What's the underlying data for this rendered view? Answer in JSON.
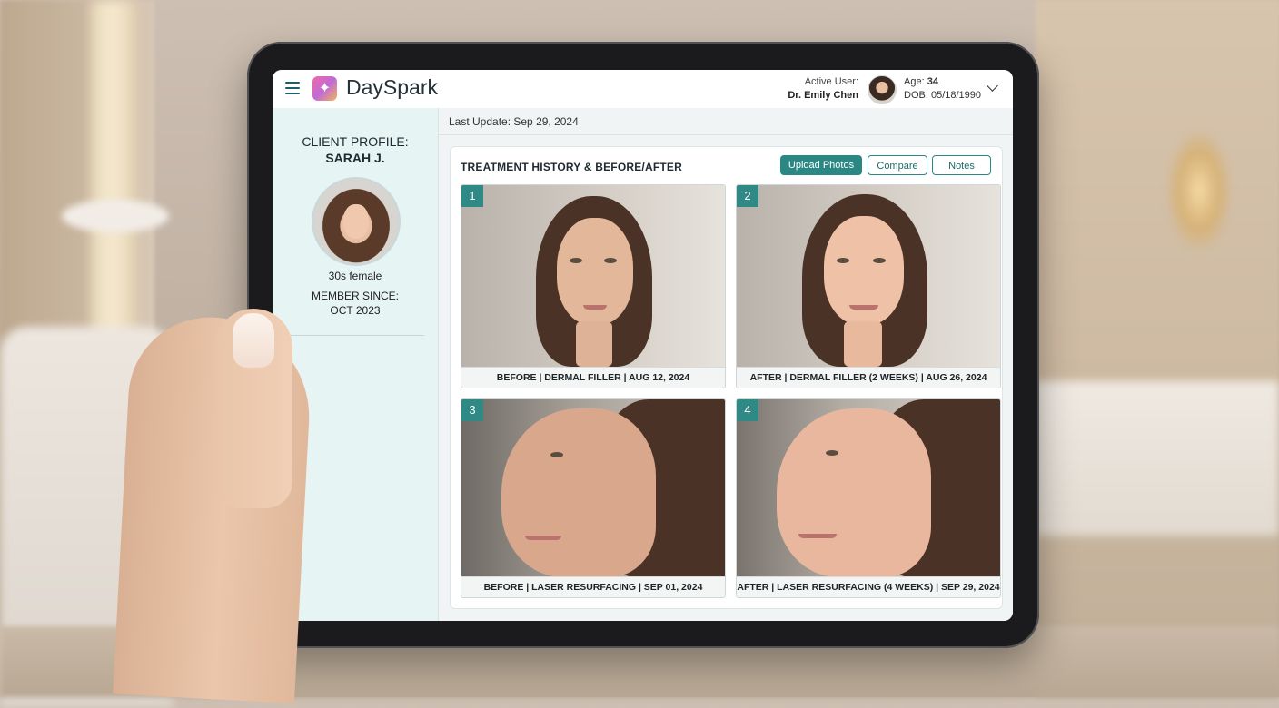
{
  "app": {
    "name": "DaySpark"
  },
  "header": {
    "active_user_label": "Active User:",
    "active_user_name": "Dr. Emily Chen",
    "age_label": "Age:",
    "age_value": "34",
    "dob_label": "DOB:",
    "dob_value": "05/18/1990"
  },
  "sidebar": {
    "profile_label": "CLIENT PROFILE:",
    "client_name": "SARAH J.",
    "description": "30s female",
    "member_since_label": "MEMBER SINCE:",
    "member_since_value": "OCT 2023"
  },
  "main": {
    "last_update": "Last Update: Sep 29, 2024",
    "section_title": "TREATMENT HISTORY & BEFORE/AFTER",
    "buttons": {
      "upload": "Upload Photos",
      "compare": "Compare",
      "notes": "Notes"
    },
    "photos": [
      {
        "number": "1",
        "caption": "BEFORE | DERMAL FILLER | AUG 12, 2024"
      },
      {
        "number": "2",
        "caption": "AFTER | DERMAL FILLER (2 WEEKS) | AUG 26, 2024"
      },
      {
        "number": "3",
        "caption": "BEFORE | LASER RESURFACING | SEP 01, 2024"
      },
      {
        "number": "4",
        "caption": "AFTER | LASER RESURFACING (4 WEEKS) | SEP 29, 2024"
      }
    ]
  },
  "colors": {
    "accent": "#2b8784",
    "sidebar_bg": "#e7f4f4",
    "text_dark": "#1f2a30"
  },
  "icons": [
    "menu-icon",
    "app-logo-icon",
    "chevron-down-icon"
  ]
}
